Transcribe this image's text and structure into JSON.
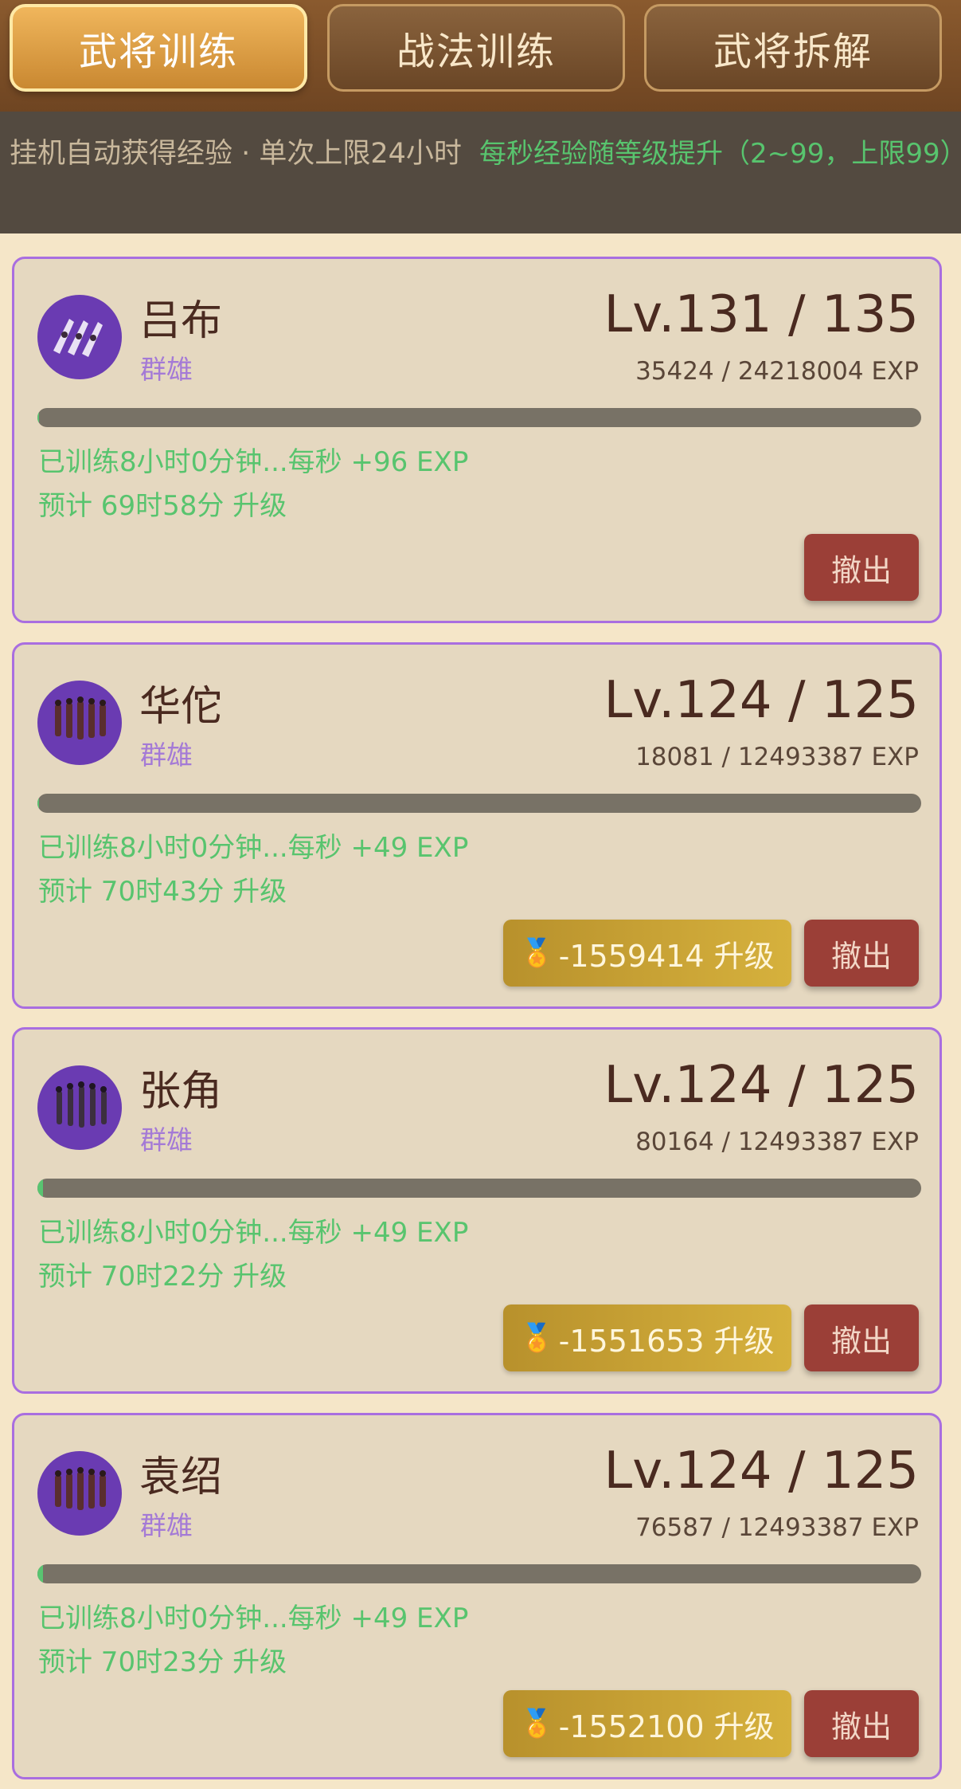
{
  "tabs": [
    {
      "label": "武将训练",
      "active": true
    },
    {
      "label": "战法训练",
      "active": false
    },
    {
      "label": "武将拆解",
      "active": false
    }
  ],
  "notice": {
    "left": "挂机自动获得经验 · 单次上限24小时",
    "right": "每秒经验随等级提升（2~99，上限99）"
  },
  "colors": {
    "accent": "#a96ee0",
    "green": "#58c46e",
    "withdraw": "#9b3f37",
    "upgrade": "#c9a233"
  },
  "buttons": {
    "withdraw": "撤出",
    "medal_icon": "🏅"
  },
  "cards": [
    {
      "name": "吕布",
      "faction": "群雄",
      "level": "Lv.131 / 135",
      "exp": "35424 / 24218004 EXP",
      "progress": 0.0015,
      "train": "已训练8小时0分钟...每秒 +96 EXP",
      "eta": "预计 69时58分 升级",
      "upgrade": null
    },
    {
      "name": "华佗",
      "faction": "群雄",
      "level": "Lv.124 / 125",
      "exp": "18081 / 12493387 EXP",
      "progress": 0.0014,
      "train": "已训练8小时0分钟...每秒 +49 EXP",
      "eta": "预计 70时43分 升级",
      "upgrade": "-1559414 升级"
    },
    {
      "name": "张角",
      "faction": "群雄",
      "level": "Lv.124 / 125",
      "exp": "80164 / 12493387 EXP",
      "progress": 0.0064,
      "train": "已训练8小时0分钟...每秒 +49 EXP",
      "eta": "预计 70时22分 升级",
      "upgrade": "-1551653 升级"
    },
    {
      "name": "袁绍",
      "faction": "群雄",
      "level": "Lv.124 / 125",
      "exp": "76587 / 12493387 EXP",
      "progress": 0.0061,
      "train": "已训练8小时0分钟...每秒 +49 EXP",
      "eta": "预计 70时23分 升级",
      "upgrade": "-1552100 升级"
    }
  ]
}
